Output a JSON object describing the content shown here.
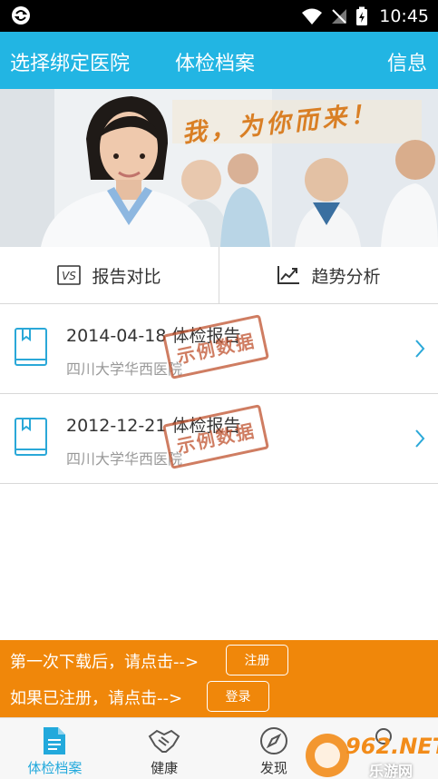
{
  "status_bar": {
    "time": "10:45"
  },
  "header": {
    "left": "选择绑定医院",
    "title": "体检档案",
    "right": "信息"
  },
  "banner": {
    "slogan": "我，为你而来！"
  },
  "actions": [
    {
      "label": "报告对比",
      "icon": "vs-icon"
    },
    {
      "label": "趋势分析",
      "icon": "trend-chart-icon"
    }
  ],
  "reports": [
    {
      "title": "2014-04-18 体检报告",
      "hospital": "四川大学华西医院",
      "stamp": "示例数据"
    },
    {
      "title": "2012-12-21 体检报告",
      "hospital": "四川大学华西医院",
      "stamp": "示例数据"
    }
  ],
  "prompt": {
    "line1": "第一次下载后，请点击-->",
    "register": "注册",
    "line2": "如果已注册，请点击-->",
    "login": "登录"
  },
  "tabs": [
    {
      "label": "体检档案",
      "active": true
    },
    {
      "label": "健康",
      "active": false
    },
    {
      "label": "发现",
      "active": false
    },
    {
      "label": "",
      "active": false
    }
  ],
  "watermark": {
    "brand": "962.NET",
    "subtitle": "乐游网"
  },
  "colors": {
    "primary": "#22b5e3",
    "accent": "#f0870a",
    "stamp": "#c0522e"
  }
}
